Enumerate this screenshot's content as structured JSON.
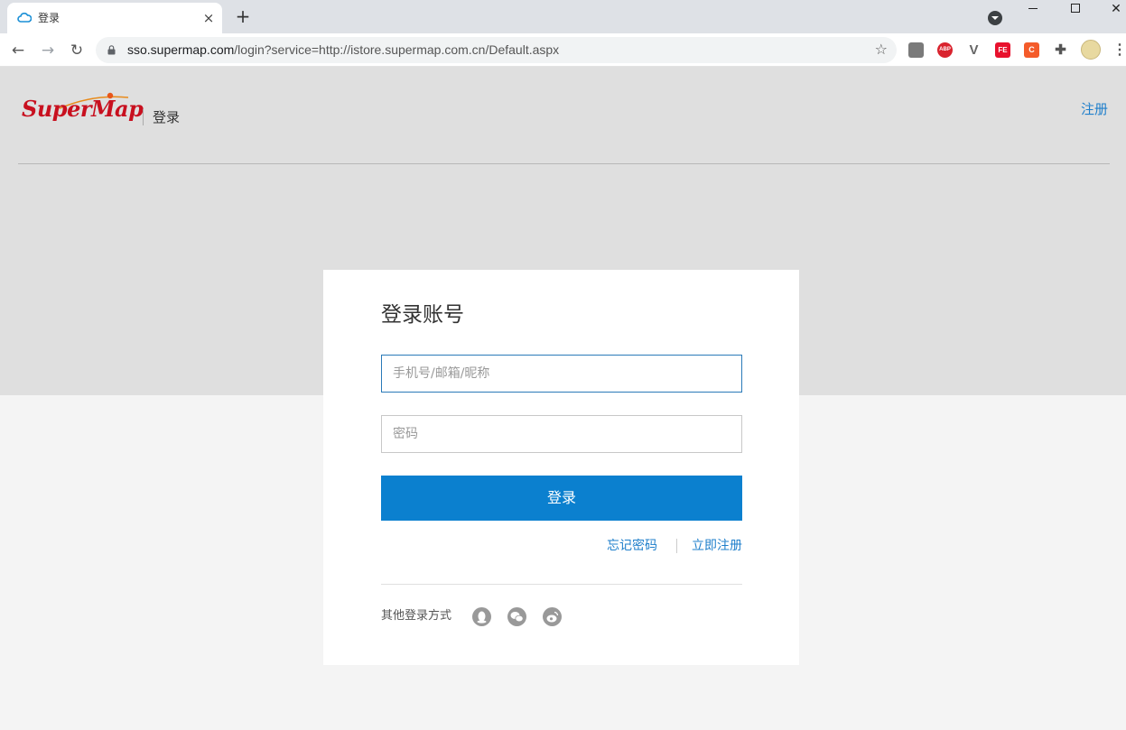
{
  "browser": {
    "tab_title": "登录",
    "tab_close": "×",
    "new_tab": "+",
    "url_host": "sso.supermap.com",
    "url_rest": "/login?service=http://istore.supermap.com.cn/Default.aspx",
    "back": "←",
    "forward": "→",
    "reload": "↻",
    "bookmark_star": "☆",
    "extensions": {
      "abp": "ABP",
      "v": "V",
      "fe": "FE",
      "c": "C",
      "puzzle": "✚",
      "menu": "⋮"
    },
    "window_close": "✕"
  },
  "header": {
    "logo_text": "SuperMap",
    "title": "登录",
    "register_link": "注册"
  },
  "login_card": {
    "title": "登录账号",
    "username_placeholder": "手机号/邮箱/昵称",
    "password_placeholder": "密码",
    "login_button": "登录",
    "forgot_password": "忘记密码",
    "register_now": "立即注册",
    "other_login_label": "其他登录方式",
    "social_icons": [
      "qq-icon",
      "wechat-icon",
      "weibo-icon"
    ]
  },
  "colors": {
    "brand_red": "#c8101f",
    "link_blue": "#1f7fcb",
    "button_blue": "#0b80cf",
    "header_bg": "#dfdfdf",
    "page_bg": "#f4f4f4"
  }
}
